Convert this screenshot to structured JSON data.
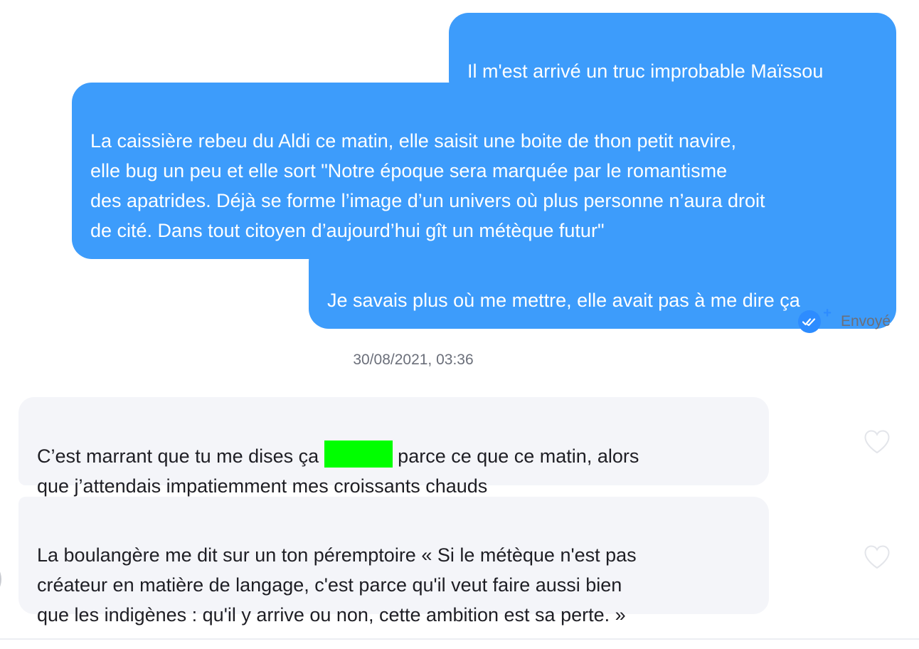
{
  "messages_out": [
    {
      "text": "Il m'est arrivé un truc improbable Maïssou"
    },
    {
      "text": "La caissière rebeu du Aldi ce matin, elle saisit une boite de thon petit navire,\nelle bug un peu et elle sort \"Notre époque sera marquée par le romantisme\ndes apatrides. Déjà se forme l’image d’un univers où plus personne n’aura droit\nde cité. Dans tout citoyen d’aujourd’hui gît un métèque futur\""
    },
    {
      "text": "Je savais plus où me mettre, elle avait pas à me dire ça"
    }
  ],
  "status": {
    "label": "Envoyé",
    "icon": "double-check-icon",
    "plus_glyph": "+",
    "color": "#2d8cff"
  },
  "timestamp": "30/08/2021, 03:36",
  "messages_in": [
    {
      "text_before": "C’est marrant que tu me dises ça ",
      "redaction_color": "#00ff00",
      "text_after": " parce ce que ce matin, alors\nque j’attendais impatiemment mes croissants chauds"
    },
    {
      "text": "La boulangère me dit sur un ton péremptoire « Si le métèque n'est pas\ncréateur en matière de langage, c'est parce qu'il veut faire aussi bien\nque les indigènes : qu'il y arrive ou non, cette ambition est sa perte. »"
    }
  ],
  "colors": {
    "sent_bubble": "#3d9cfb",
    "received_bubble": "#f4f5f9",
    "meta_text": "#6b6f7a"
  }
}
